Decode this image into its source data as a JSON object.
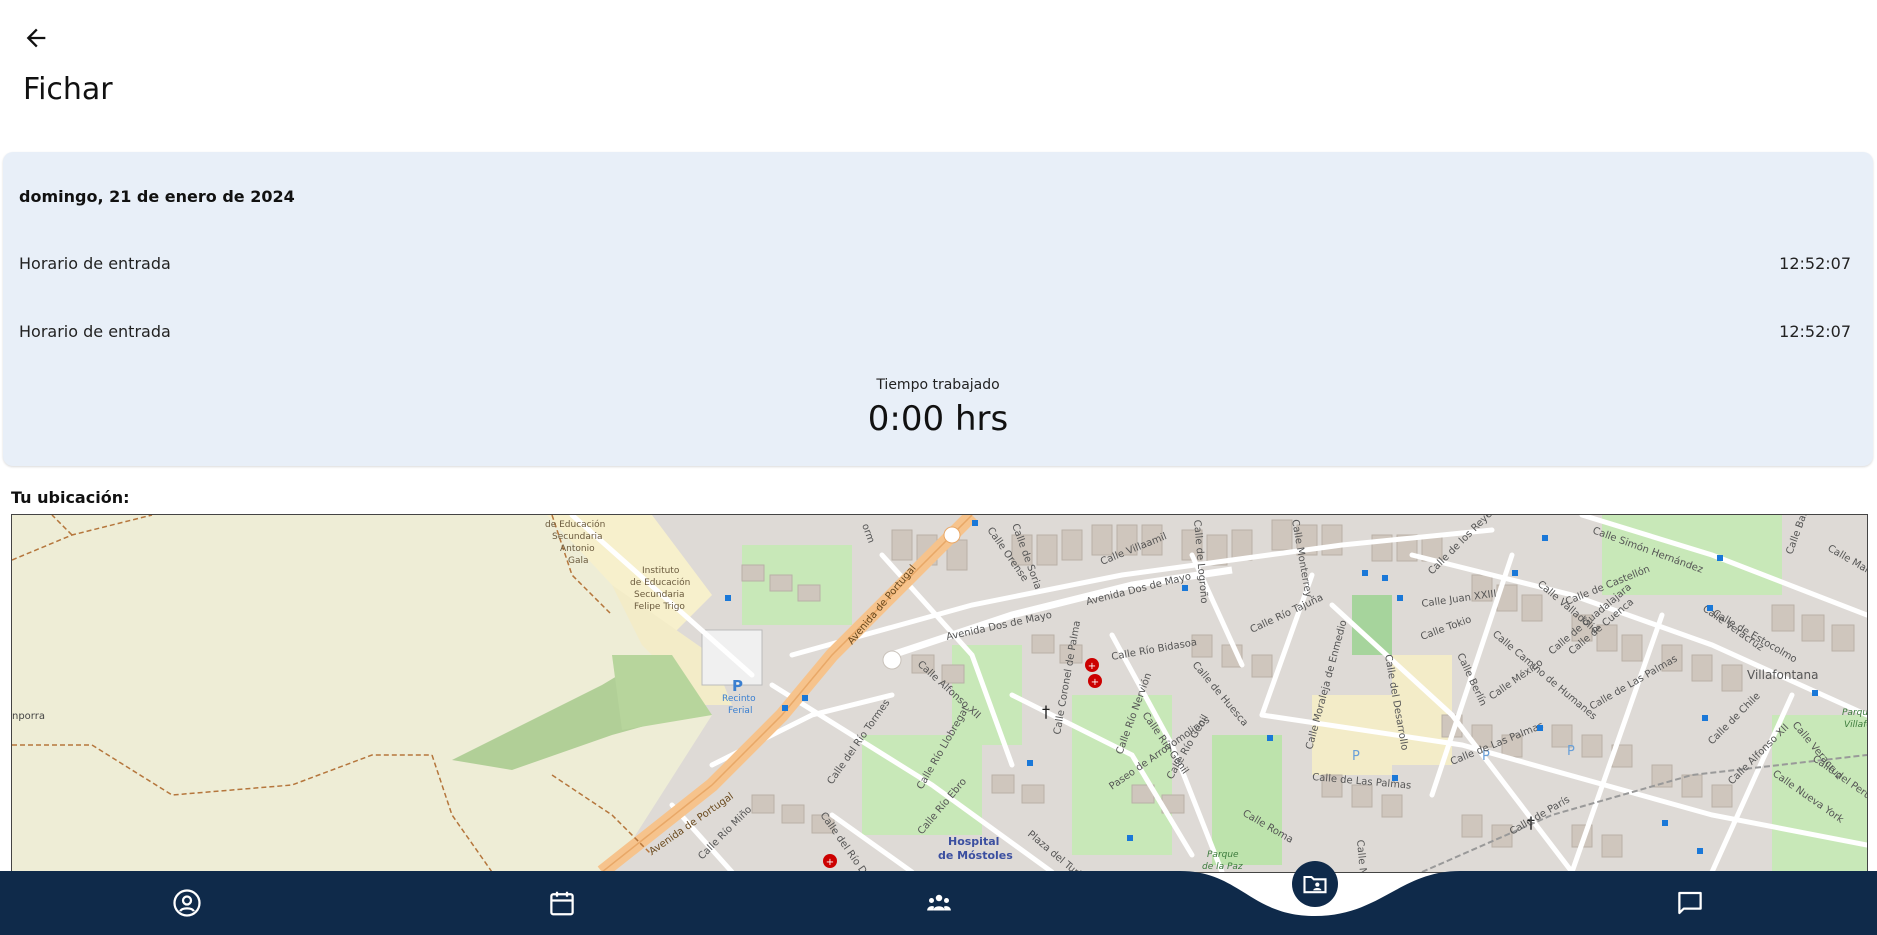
{
  "header": {
    "back_icon": "arrow-left-icon",
    "title": "Fichar"
  },
  "card": {
    "date": "domingo, 21 de enero de 2024",
    "rows": [
      {
        "label": "Horario de entrada",
        "value": "12:52:07"
      },
      {
        "label": "Horario de entrada",
        "value": "12:52:07"
      }
    ],
    "worked_label": "Tiempo trabajado",
    "worked_value": "0:00 hrs"
  },
  "location": {
    "label": "Tu ubicación:",
    "map_labels": {
      "instituto1": "de Educación Secundaria Antonio Gala",
      "instituto2": "Instituto de Educación Secundaria Felipe Trigo",
      "recinto": "Recinto Ferial",
      "hospital": "Hospital de Móstoles",
      "parque": "Parque de la Paz",
      "villafontana": "Villafontana",
      "avenida_portugal": "Avenida de Portugal",
      "avenida_dos_de_mayo": "Avenida Dos de Mayo",
      "calle_villaamil": "Calle Villaamil",
      "calle_simon_hernandez": "Calle Simón Hernández",
      "calle_juan_xxiii": "Calle Juan XXIII",
      "calle_tokio": "Calle Tokio",
      "calle_las_palmas": "Calle de Las Palmas",
      "calle_rio_genil": "Calle Río Genil",
      "paseo_arroyomolinos": "Paseo de Arroyomolinos",
      "calle_alfonso_xii": "Calle Alfonso XII",
      "calle_rio_tormes": "Calle del Río Tormes",
      "calle_rio_duero": "Calle del Río Duero",
      "calle_turia": "Plaza del Turia",
      "calle_castellon": "Calle de Castellón",
      "calle_estocolmo": "Calle de Estocolmo",
      "calle_rio_bidasoa": "Calle Río Bidasoa",
      "calle_huesca": "Calle de Huesca",
      "calle_moraleja": "Calle Moraleja de Enmedio",
      "calle_desarrollo": "Calle del Desarrollo",
      "calle_roma": "Calle Roma",
      "calle_mexico": "Calle México",
      "calle_humanes": "Calle Camino de Humanes",
      "calle_paris": "Calle de París",
      "calle_chile": "Calle de Chile",
      "calle_veracruz": "Calle Veracruz",
      "calle_peru": "Calle del Perú",
      "calle_nueva_york": "Calle Nueva York",
      "calle_rio_ebro": "Calle Río Ebro",
      "calle_rio_mino": "Calle Río Miño",
      "calle_llobregat": "Calle Río Llobregat",
      "calle_coronel": "Calle Coronel de Palma",
      "calle_rio_tajuna": "Calle Río Tajuña",
      "calle_orense": "Calle Orense",
      "calle_soria": "Calle de Soria",
      "calle_logrono": "Calle de Logroño",
      "calle_berlin": "Calle Berlín",
      "calle_cuenca": "Calle de Cuenca",
      "calle_guadalajara": "Calle de Guadalajara",
      "calle_valladolid": "Calle Valladolid",
      "calle_reyes": "Calle de los Reyes Católicos",
      "calle_balea": "Calle Bale",
      "calle_mallo": "Calle Mallo",
      "calle_rio_nervion": "Calle Río Nervión",
      "calle_monterrey": "Calle Monterrey",
      "calle_napoles": "Calle Nápoles",
      "calle_alfonso_xii_b": "Calle Alfonso XII",
      "calle_nemporra": "nporra",
      "calle_villafontana_park": "Parque Villafontana",
      "calle_orm": "orm"
    }
  },
  "bottom_nav": {
    "items": [
      {
        "icon": "user-circle-icon"
      },
      {
        "icon": "calendar-icon"
      },
      {
        "icon": "team-icon"
      },
      {
        "icon": "folder-user-icon",
        "active": true
      },
      {
        "icon": "chat-icon"
      }
    ],
    "colors": {
      "bar": "#0f2a4a",
      "active_bubble": "#0f2a4a",
      "icon": "#ffffff"
    }
  }
}
